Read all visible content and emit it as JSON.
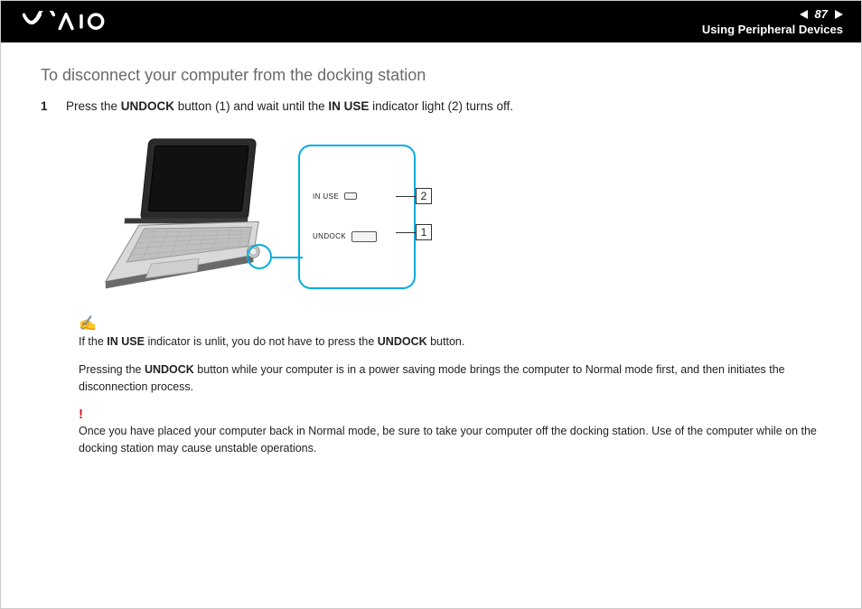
{
  "header": {
    "page_number": "87",
    "section": "Using Peripheral Devices",
    "logo_name": "VAIO"
  },
  "title": "To disconnect your computer from the docking station",
  "step1": {
    "num": "1",
    "text_before": "Press the ",
    "bold1": "UNDOCK",
    "text_mid1": " button (1) and wait until the ",
    "bold2": "IN USE",
    "text_after": " indicator light (2) turns off."
  },
  "callout": {
    "label_in_use": "IN USE",
    "label_undock": "UNDOCK",
    "num1": "1",
    "num2": "2"
  },
  "note1": {
    "t1": "If the ",
    "b1": "IN USE",
    "t2": " indicator is unlit, you do not have to press the ",
    "b2": "UNDOCK",
    "t3": " button."
  },
  "note2": {
    "t1": "Pressing the ",
    "b1": "UNDOCK",
    "t2": " button while your computer is in a power saving mode brings the computer to Normal mode first, and then initiates the disconnection process."
  },
  "warn": {
    "icon": "!",
    "text": "Once you have placed your computer back in Normal mode, be sure to take your computer off the docking station. Use of the computer while on the docking station may cause unstable operations."
  }
}
